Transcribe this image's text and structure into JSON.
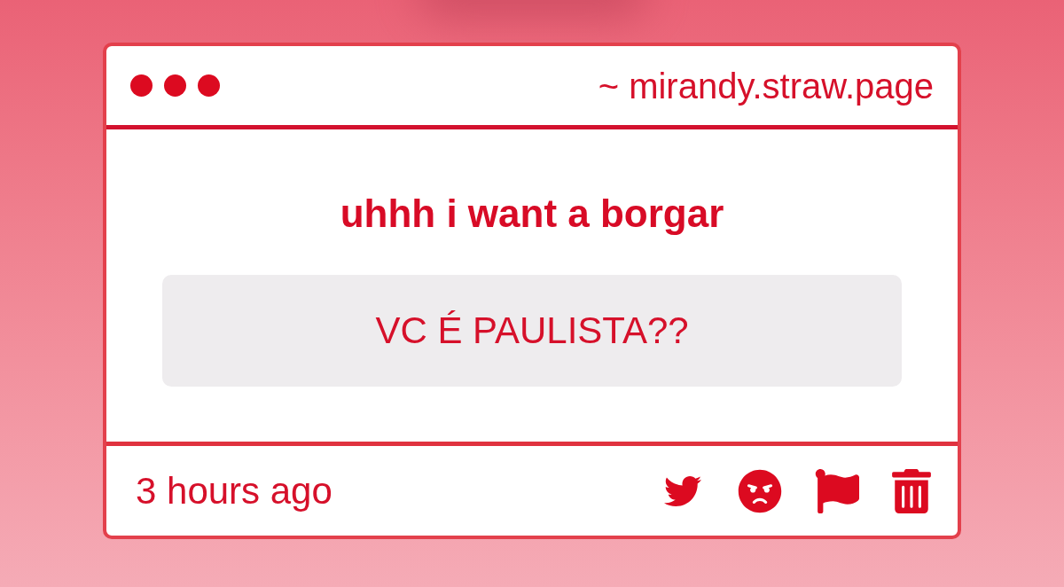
{
  "window": {
    "address": "~ mirandy.straw.page"
  },
  "post": {
    "title": "uhhh i want a borgar",
    "message": "VC É PAULISTA??"
  },
  "footer": {
    "time": "3 hours ago"
  }
}
